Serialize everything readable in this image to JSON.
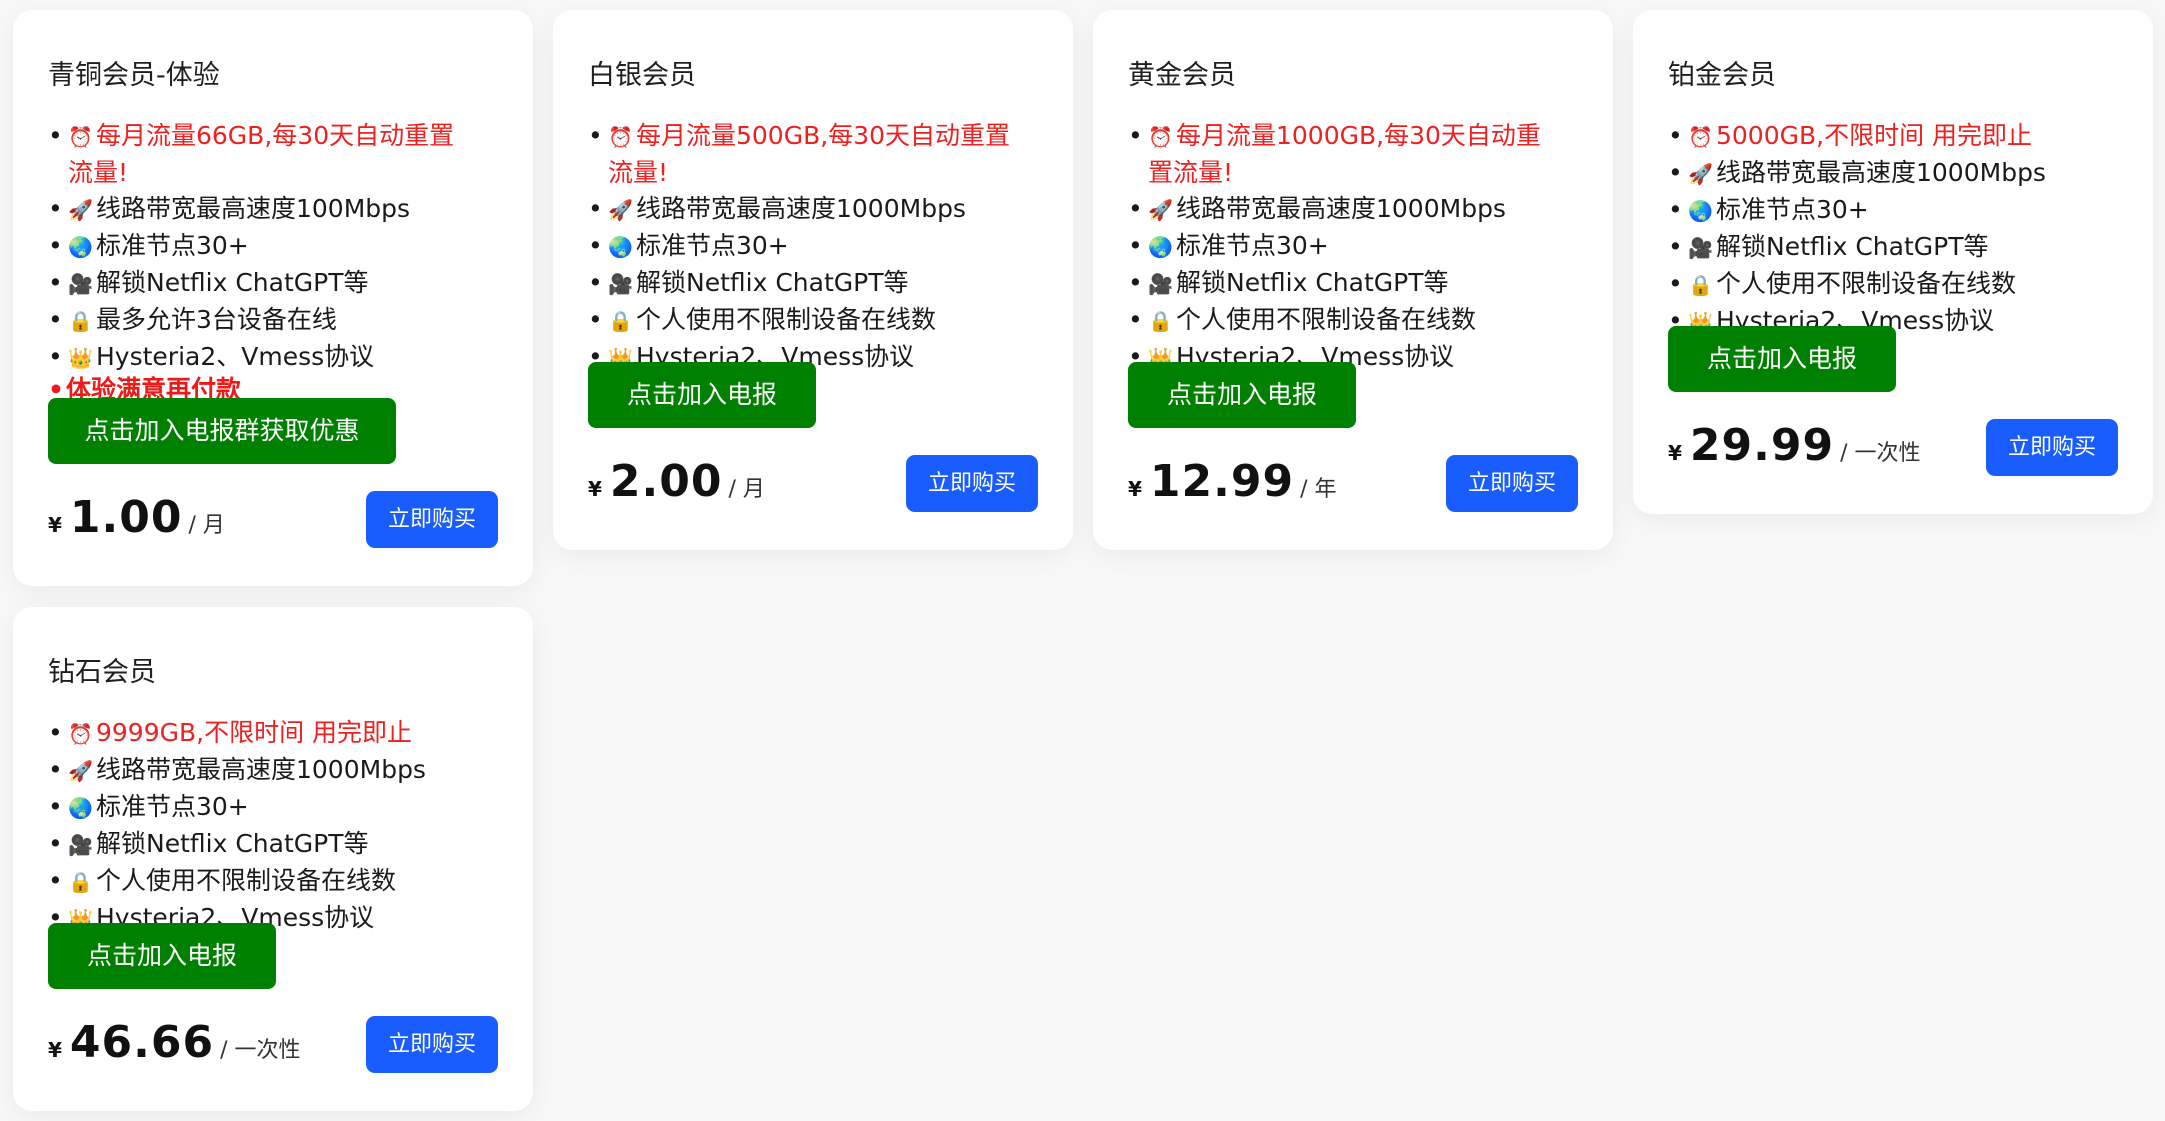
{
  "plans": [
    {
      "title": "青铜会员-体验",
      "features": [
        {
          "icon": "⏰",
          "text": "每月流量66GB,每30天自动重置流量!",
          "red": true
        },
        {
          "icon": "🚀",
          "text": "线路带宽最高速度100Mbps"
        },
        {
          "icon": "🌏",
          "text": "标准节点30+"
        },
        {
          "icon": "🎥",
          "text": "解锁Netflix ChatGPT等"
        },
        {
          "icon": "🔒",
          "text": "最多允许3台设备在线"
        },
        {
          "icon": "👑",
          "text": "Hysteria2、Vmess协议"
        }
      ],
      "promo": "体验满意再付款",
      "telegram_button": "点击加入电报群获取优惠码",
      "currency": "¥",
      "price": "1.00",
      "period": "/ 月",
      "buy_button": "立即购买"
    },
    {
      "title": "白银会员",
      "features": [
        {
          "icon": "⏰",
          "text": "每月流量500GB,每30天自动重置流量!",
          "red": true
        },
        {
          "icon": "🚀",
          "text": "线路带宽最高速度1000Mbps"
        },
        {
          "icon": "🌏",
          "text": "标准节点30+"
        },
        {
          "icon": "🎥",
          "text": "解锁Netflix ChatGPT等"
        },
        {
          "icon": "🔒",
          "text": "个人使用不限制设备在线数"
        },
        {
          "icon": "👑",
          "text": "Hysteria2、Vmess协议"
        }
      ],
      "telegram_button": "点击加入电报群",
      "currency": "¥",
      "price": "2.00",
      "period": "/ 月",
      "buy_button": "立即购买"
    },
    {
      "title": "黄金会员",
      "features": [
        {
          "icon": "⏰",
          "text": "每月流量1000GB,每30天自动重置流量!",
          "red": true
        },
        {
          "icon": "🚀",
          "text": "线路带宽最高速度1000Mbps"
        },
        {
          "icon": "🌏",
          "text": "标准节点30+"
        },
        {
          "icon": "🎥",
          "text": "解锁Netflix ChatGPT等"
        },
        {
          "icon": "🔒",
          "text": "个人使用不限制设备在线数"
        },
        {
          "icon": "👑",
          "text": "Hysteria2、Vmess协议"
        }
      ],
      "telegram_button": "点击加入电报群",
      "currency": "¥",
      "price": "12.99",
      "period": "/ 年",
      "buy_button": "立即购买"
    },
    {
      "title": "铂金会员",
      "features": [
        {
          "icon": "⏰",
          "text": "5000GB,不限时间 用完即止",
          "red": true
        },
        {
          "icon": "🚀",
          "text": "线路带宽最高速度1000Mbps"
        },
        {
          "icon": "🌏",
          "text": "标准节点30+"
        },
        {
          "icon": "🎥",
          "text": "解锁Netflix ChatGPT等"
        },
        {
          "icon": "🔒",
          "text": "个人使用不限制设备在线数"
        },
        {
          "icon": "👑",
          "text": "Hysteria2、Vmess协议"
        }
      ],
      "telegram_button": "点击加入电报群",
      "currency": "¥",
      "price": "29.99",
      "period": "/ 一次性",
      "buy_button": "立即购买"
    },
    {
      "title": "钻石会员",
      "features": [
        {
          "icon": "⏰",
          "text": "9999GB,不限时间 用完即止",
          "red": true
        },
        {
          "icon": "🚀",
          "text": "线路带宽最高速度1000Mbps"
        },
        {
          "icon": "🌏",
          "text": "标准节点30+"
        },
        {
          "icon": "🎥",
          "text": "解锁Netflix ChatGPT等"
        },
        {
          "icon": "🔒",
          "text": "个人使用不限制设备在线数"
        },
        {
          "icon": "👑",
          "text": "Hysteria2、Vmess协议"
        }
      ],
      "telegram_button": "点击加入电报群",
      "currency": "¥",
      "price": "46.66",
      "period": "/ 一次性",
      "buy_button": "立即购买"
    }
  ],
  "colors": {
    "telegram_button": "#008000",
    "buy_button": "#1a5dff",
    "highlight_text": "#ee2020"
  }
}
